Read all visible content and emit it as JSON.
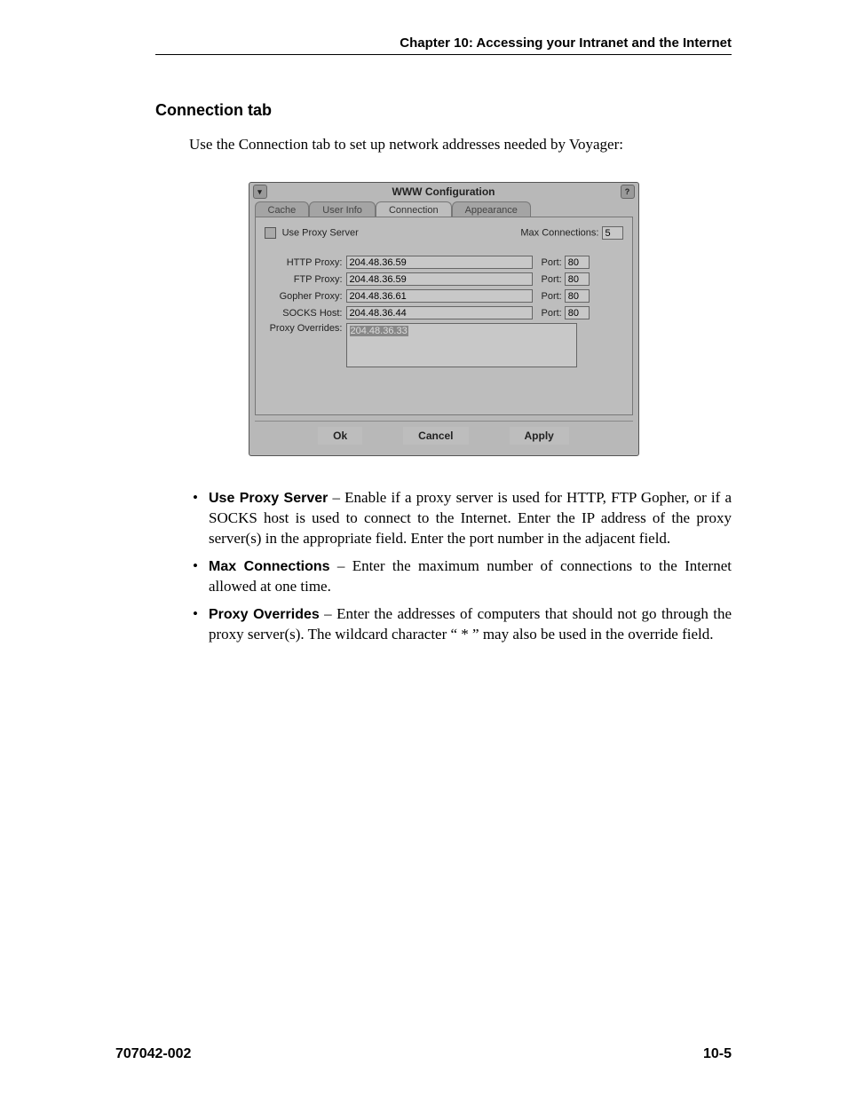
{
  "header": {
    "chapter": "Chapter 10: Accessing your Intranet and the Internet"
  },
  "section": {
    "heading": "Connection tab"
  },
  "intro": "Use the Connection tab to set up network addresses needed by Voyager:",
  "dialog": {
    "title": "WWW Configuration",
    "tabs": {
      "cache": "Cache",
      "userinfo": "User Info",
      "connection": "Connection",
      "appearance": "Appearance"
    },
    "use_proxy_label": "Use Proxy Server",
    "max_conn_label": "Max Connections:",
    "max_conn_value": "5",
    "port_label": "Port:",
    "rows": {
      "http": {
        "label": "HTTP Proxy:",
        "value": "204.48.36.59",
        "port": "80"
      },
      "ftp": {
        "label": "FTP Proxy:",
        "value": "204.48.36.59",
        "port": "80"
      },
      "gopher": {
        "label": "Gopher Proxy:",
        "value": "204.48.36.61",
        "port": "80"
      },
      "socks": {
        "label": "SOCKS Host:",
        "value": "204.48.36.44",
        "port": "80"
      }
    },
    "overrides_label": "Proxy Overrides:",
    "overrides_value": "204.48.36.33",
    "buttons": {
      "ok": "Ok",
      "cancel": "Cancel",
      "apply": "Apply"
    }
  },
  "bullets": {
    "b1_term": "Use Proxy Server",
    "b1_text": " – Enable if a proxy server is used for HTTP, FTP Gopher, or if a SOCKS host is used to connect to the Internet. Enter the IP address of the proxy server(s) in the appropriate field. Enter the port number in the adjacent field.",
    "b2_term": "Max Connections",
    "b2_text": " – Enter the maximum number of connections to the Internet allowed at one time.",
    "b3_term": "Proxy Overrides",
    "b3_text": " – Enter the addresses of computers that should not go through the proxy server(s). The wildcard character “ * ” may also be used in the override field."
  },
  "footer": {
    "docnum": "707042-002",
    "pagenum": "10-5"
  }
}
